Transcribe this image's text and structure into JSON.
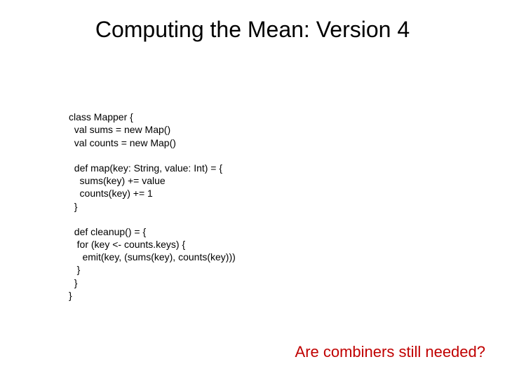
{
  "title": "Computing the Mean: Version 4",
  "code": {
    "l1": "class Mapper {",
    "l2": "  val sums = new Map()",
    "l3": "  val counts = new Map()",
    "l4": "",
    "l5": "  def map(key: String, value: Int) = {",
    "l6": "    sums(key) += value",
    "l7": "    counts(key) += 1",
    "l8": "  }",
    "l9": "",
    "l10": "  def cleanup() = {",
    "l11": "   for (key <- counts.keys) {",
    "l12": "     emit(key, (sums(key), counts(key)))",
    "l13": "   }",
    "l14": "  }",
    "l15": "}"
  },
  "footnote": "Are combiners still needed?"
}
